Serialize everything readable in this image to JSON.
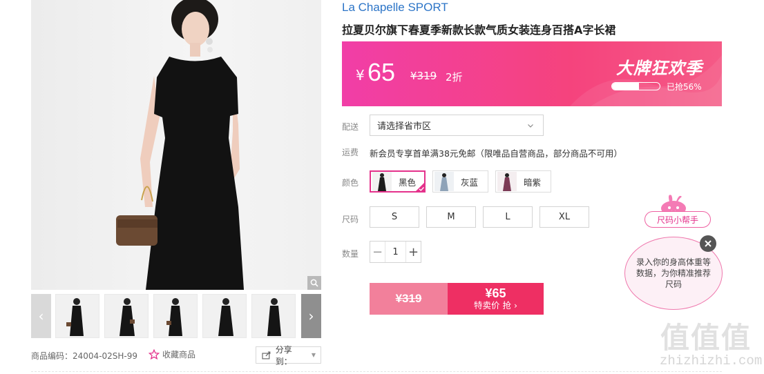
{
  "product": {
    "brand": "La Chapelle SPORT",
    "title": "拉夏贝尔旗下春夏季新款长款气质女装连身百搭A字长裙",
    "code_label": "商品编码：",
    "code": "24004-02SH-99",
    "favorite_label": "收藏商品",
    "share_label": "分享到："
  },
  "price": {
    "currency": "¥",
    "now": "65",
    "original": "¥319",
    "discount": "2折",
    "promo_title": "大牌狂欢季",
    "sold_text": "已抢56%",
    "sold_fraction": 0.56
  },
  "delivery": {
    "label": "配送",
    "placeholder": "请选择省市区"
  },
  "shipping": {
    "label": "运费",
    "text": "新会员专享首单满38元免邮（限唯品自营商品，部分商品不可用）"
  },
  "colors": {
    "label": "颜色",
    "options": [
      {
        "name": "黑色",
        "selected": true,
        "swatch": "#1b1b1b"
      },
      {
        "name": "灰蓝",
        "selected": false,
        "swatch": "#8fa3b8"
      },
      {
        "name": "暗紫",
        "selected": false,
        "swatch": "#7b3a55"
      }
    ]
  },
  "sizes": {
    "label": "尺码",
    "options": [
      "S",
      "M",
      "L",
      "XL"
    ]
  },
  "quantity": {
    "label": "数量",
    "value": "1",
    "minus": "−",
    "plus": "+"
  },
  "buy": {
    "original": "¥319",
    "sale_price": "¥65",
    "sale_text": "特卖价 抢 ›"
  },
  "size_helper": {
    "tag": "尺码小帮手",
    "bubble": "录入你的身高体重等数据，为你精准推荐尺码"
  },
  "watermark": {
    "zh": "值值值",
    "en": "zhizhizhi.com"
  },
  "colors_theme": {
    "accent": "#e4318b",
    "brand_blue": "#2b74c7",
    "buy_red": "#ee2f63"
  }
}
